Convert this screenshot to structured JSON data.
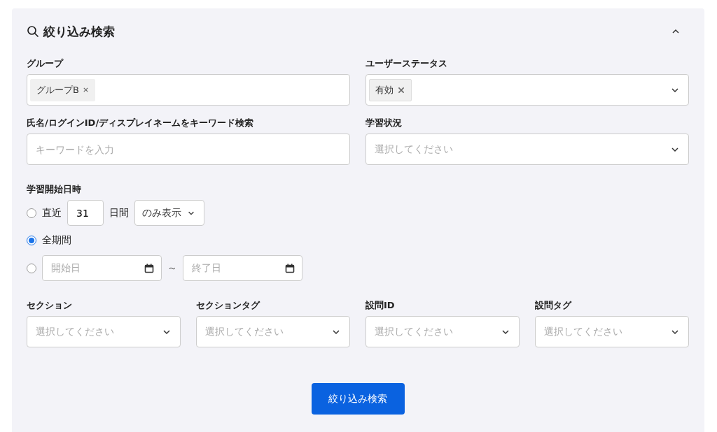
{
  "panel": {
    "title": "絞り込み検索",
    "expanded": true
  },
  "filters": [
    {
      "label": "グループ",
      "kind": "tags",
      "tags": [
        "グループB"
      ]
    },
    {
      "label": "ユーザーステータス",
      "kind": "tag-select",
      "tags": [
        "有効"
      ]
    },
    {
      "label": "氏名/ログインID/ディスプレイネームをキーワード検索",
      "kind": "text",
      "placeholder": "キーワードを入力"
    },
    {
      "label": "学習状況",
      "kind": "select",
      "placeholder": "選択してください"
    }
  ],
  "start_date": {
    "label": "学習開始日時",
    "options": [
      {
        "kind": "recent",
        "selected": false,
        "prefix": "直近",
        "days": "31",
        "suffix": "日間",
        "mode": "のみ表示"
      },
      {
        "kind": "all",
        "selected": true,
        "label": "全期間"
      },
      {
        "kind": "range",
        "selected": false,
        "from_placeholder": "開始日",
        "separator": "～",
        "to_placeholder": "終了日"
      }
    ]
  },
  "selects": [
    {
      "label": "セクション",
      "placeholder": "選択してください"
    },
    {
      "label": "セクションタグ",
      "placeholder": "選択してください"
    },
    {
      "label": "設問ID",
      "placeholder": "選択してください"
    },
    {
      "label": "設問タグ",
      "placeholder": "選択してください"
    }
  ],
  "submit": "絞り込み検索"
}
